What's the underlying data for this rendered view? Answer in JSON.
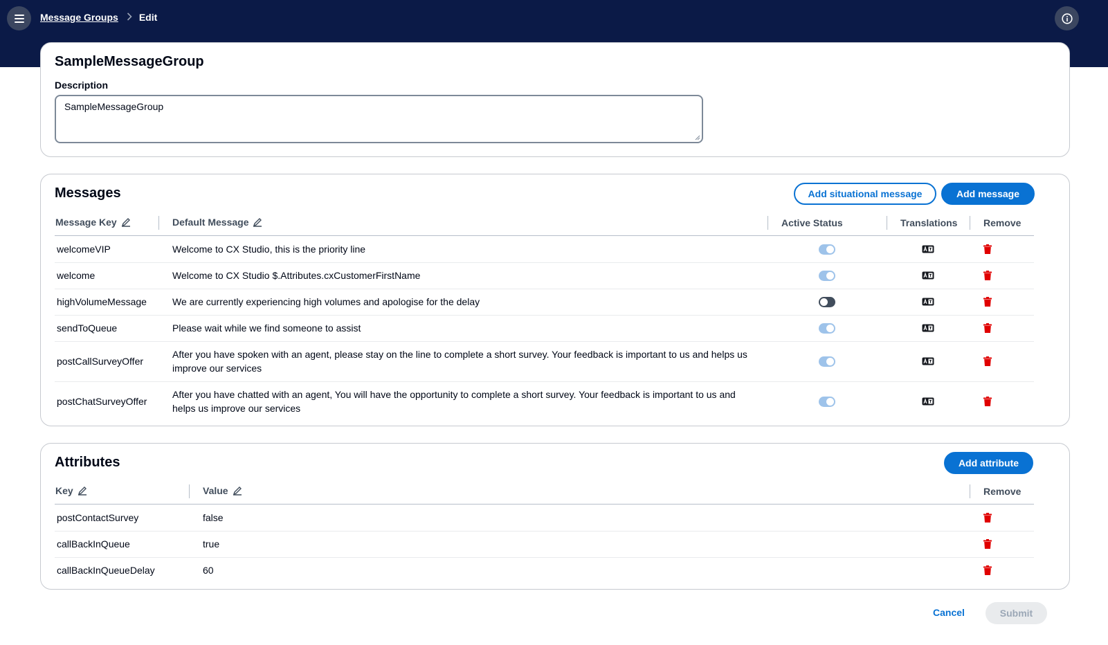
{
  "breadcrumb": {
    "parent": "Message Groups",
    "current": "Edit"
  },
  "icons": {
    "menu": "hamburger-icon",
    "info": "info-icon",
    "edit": "pencil-icon",
    "translations": "translate-icon",
    "remove": "trash-icon"
  },
  "colors": {
    "header": "#0b1a47",
    "primary": "#0972d3",
    "danger": "#e00000",
    "toggle_on": "#9ec3ea",
    "toggle_off": "#414d5c"
  },
  "group": {
    "name": "SampleMessageGroup",
    "description_label": "Description",
    "description_value": "SampleMessageGroup"
  },
  "messages": {
    "title": "Messages",
    "add_situational_label": "Add situational message",
    "add_message_label": "Add message",
    "columns": {
      "key": "Message Key",
      "default": "Default Message",
      "active": "Active Status",
      "translations": "Translations",
      "remove": "Remove"
    },
    "rows": [
      {
        "key": "welcomeVIP",
        "message": "Welcome to CX Studio, this is the priority line",
        "active": true
      },
      {
        "key": "welcome",
        "message": "Welcome to CX Studio $.Attributes.cxCustomerFirstName",
        "active": true
      },
      {
        "key": "highVolumeMessage",
        "message": "We are currently experiencing high volumes and apologise for the delay",
        "active": false
      },
      {
        "key": "sendToQueue",
        "message": "Please wait while we find someone to assist",
        "active": true
      },
      {
        "key": "postCallSurveyOffer",
        "message": "After you have spoken with an agent, please stay on the line to complete a short survey. Your feedback is important to us and helps us improve our services",
        "active": true
      },
      {
        "key": "postChatSurveyOffer",
        "message": "After you have chatted with an agent, You will have the opportunity to complete a short survey. Your feedback is important to us and helps us improve our services",
        "active": true
      }
    ]
  },
  "attributes": {
    "title": "Attributes",
    "add_label": "Add attribute",
    "columns": {
      "key": "Key",
      "value": "Value",
      "remove": "Remove"
    },
    "rows": [
      {
        "key": "postContactSurvey",
        "value": "false"
      },
      {
        "key": "callBackInQueue",
        "value": "true"
      },
      {
        "key": "callBackInQueueDelay",
        "value": "60"
      }
    ]
  },
  "footer": {
    "cancel_label": "Cancel",
    "submit_label": "Submit"
  }
}
